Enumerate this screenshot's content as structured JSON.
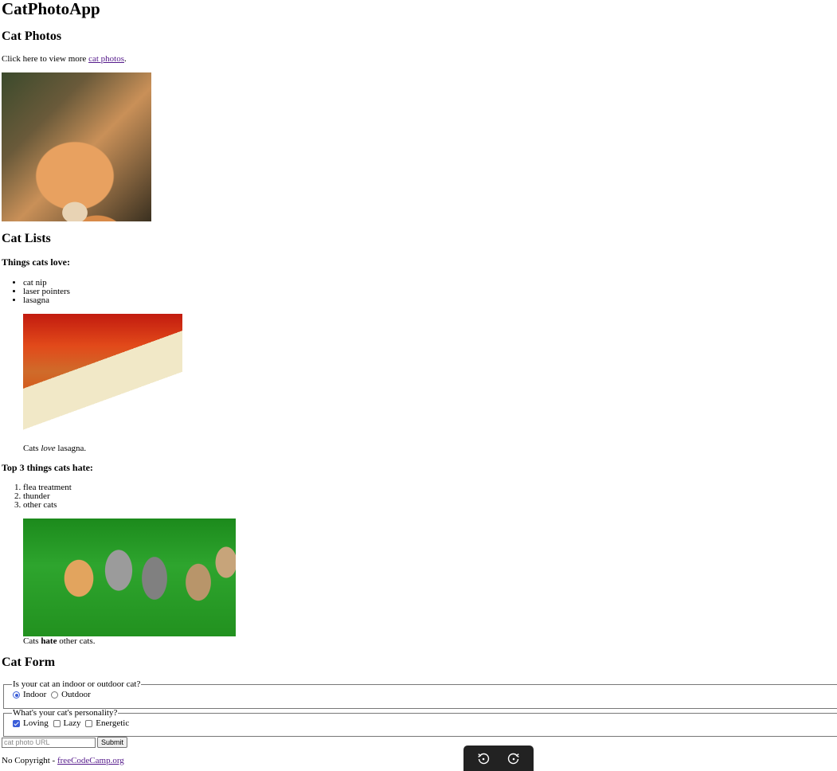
{
  "app_title": "CatPhotoApp",
  "photos_section": {
    "heading": "Cat Photos",
    "intro_prefix": "Click here to view more ",
    "link_text": "cat photos",
    "intro_suffix": ".",
    "image_alt": "A cute orange cat lying on its back."
  },
  "lists_section": {
    "heading": "Cat Lists",
    "loves_heading": "Things cats love:",
    "loves": [
      "cat nip",
      "laser pointers",
      "lasagna"
    ],
    "loves_figure": {
      "alt": "A slice of lasagna on a plate.",
      "caption_prefix": "Cats ",
      "caption_emphasis": "love",
      "caption_suffix": " lasagna."
    },
    "hates_heading": "Top 3 things cats hate:",
    "hates": [
      "flea treatment",
      "thunder",
      "other cats"
    ],
    "hates_figure": {
      "alt": "Five cats looking around a field.",
      "caption_prefix": "Cats ",
      "caption_strong": "hate",
      "caption_suffix": " other cats."
    }
  },
  "form_section": {
    "heading": "Cat Form",
    "location_legend": "Is your cat an indoor or outdoor cat?",
    "location_options": [
      {
        "label": "Indoor",
        "checked": true
      },
      {
        "label": "Outdoor",
        "checked": false
      }
    ],
    "personality_legend": "What's your cat's personality?",
    "personality_options": [
      {
        "label": "Loving",
        "checked": true
      },
      {
        "label": "Lazy",
        "checked": false
      },
      {
        "label": "Energetic",
        "checked": false
      }
    ],
    "url_placeholder": "cat photo URL",
    "submit_label": "Submit"
  },
  "footer": {
    "prefix": "No Copyright - ",
    "link_text": "freeCodeCamp.org"
  },
  "toolbar": {
    "icons": [
      "rotate-left-icon",
      "rotate-right-icon"
    ]
  },
  "colors": {
    "link": "#551a8b",
    "accent": "#3a5dd8",
    "toolbar_bg": "#222222"
  }
}
